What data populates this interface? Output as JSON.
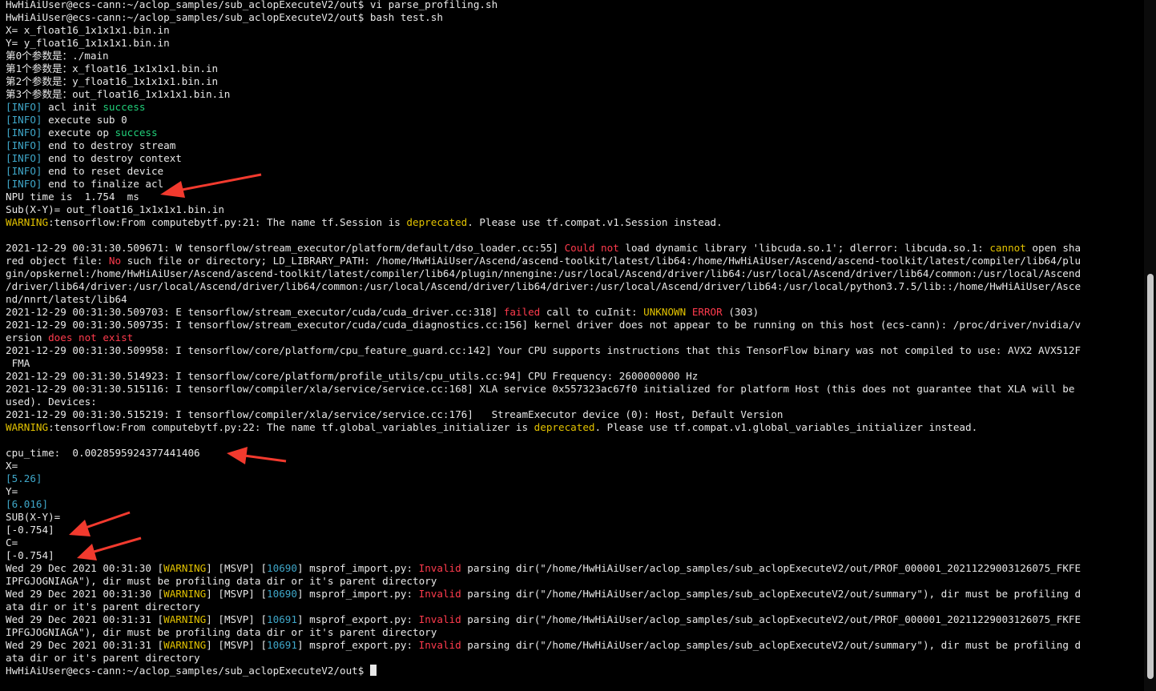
{
  "colors": {
    "background": "#000000",
    "text": "#e8e8e8",
    "cyan": "#3fa7c9",
    "green": "#21d07a",
    "yellow": "#e2c200",
    "red": "#ff3b4d",
    "annotation_arrow": "#f23a2e"
  },
  "annotation_icon": "red-arrow-icon",
  "lines": [
    [
      [
        "d",
        "HwHiAiUser@ecs-cann:~/aclop_samples/sub_aclopExecuteV2/out$ vi parse_profiling.sh"
      ]
    ],
    [
      [
        "d",
        "HwHiAiUser@ecs-cann:~/aclop_samples/sub_aclopExecuteV2/out$ bash test.sh"
      ]
    ],
    [
      [
        "d",
        "X= x_float16_1x1x1x1.bin.in"
      ]
    ],
    [
      [
        "d",
        "Y= y_float16_1x1x1x1.bin.in"
      ]
    ],
    [
      [
        "d",
        "第0个参数是：./main"
      ]
    ],
    [
      [
        "d",
        "第1个参数是：x_float16_1x1x1x1.bin.in"
      ]
    ],
    [
      [
        "d",
        "第2个参数是：y_float16_1x1x1x1.bin.in"
      ]
    ],
    [
      [
        "d",
        "第3个参数是：out_float16_1x1x1x1.bin.in"
      ]
    ],
    [
      [
        "c",
        "[INFO]"
      ],
      [
        "d",
        " acl init "
      ],
      [
        "g",
        "success"
      ]
    ],
    [
      [
        "c",
        "[INFO]"
      ],
      [
        "d",
        " execute sub 0"
      ]
    ],
    [
      [
        "c",
        "[INFO]"
      ],
      [
        "d",
        " execute op "
      ],
      [
        "g",
        "success"
      ]
    ],
    [
      [
        "c",
        "[INFO]"
      ],
      [
        "d",
        " end to destroy stream"
      ]
    ],
    [
      [
        "c",
        "[INFO]"
      ],
      [
        "d",
        " end to destroy context"
      ]
    ],
    [
      [
        "c",
        "[INFO]"
      ],
      [
        "d",
        " end to reset device"
      ]
    ],
    [
      [
        "c",
        "[INFO]"
      ],
      [
        "d",
        " end to finalize acl"
      ]
    ],
    [
      [
        "d",
        "NPU time is  1.754  ms"
      ]
    ],
    [
      [
        "d",
        "Sub(X-Y)= out_float16_1x1x1x1.bin.in"
      ]
    ],
    [
      [
        "y",
        "WARNING"
      ],
      [
        "d",
        ":tensorflow:From computebytf.py:21: The name tf.Session is "
      ],
      [
        "y",
        "deprecated"
      ],
      [
        "d",
        ". Please use tf.compat.v1.Session instead."
      ]
    ],
    [
      [
        "d",
        ""
      ]
    ],
    [
      [
        "d",
        "2021-12-29 00:31:30.509671: W tensorflow/stream_executor/platform/default/dso_loader.cc:55] "
      ],
      [
        "r",
        "Could not"
      ],
      [
        "d",
        " load dynamic library 'libcuda.so.1'; dlerror: libcuda.so.1: "
      ],
      [
        "y",
        "cannot"
      ],
      [
        "d",
        " open sha"
      ]
    ],
    [
      [
        "d",
        "red object file: "
      ],
      [
        "r",
        "No"
      ],
      [
        "d",
        " such file or directory; LD_LIBRARY_PATH: /home/HwHiAiUser/Ascend/ascend-toolkit/latest/lib64:/home/HwHiAiUser/Ascend/ascend-toolkit/latest/compiler/lib64/plu"
      ]
    ],
    [
      [
        "d",
        "gin/opskernel:/home/HwHiAiUser/Ascend/ascend-toolkit/latest/compiler/lib64/plugin/nnengine:/usr/local/Ascend/driver/lib64:/usr/local/Ascend/driver/lib64/common:/usr/local/Ascend"
      ]
    ],
    [
      [
        "d",
        "/driver/lib64/driver:/usr/local/Ascend/driver/lib64/common:/usr/local/Ascend/driver/lib64/driver:/usr/local/Ascend/driver/lib64:/usr/local/python3.7.5/lib::/home/HwHiAiUser/Asce"
      ]
    ],
    [
      [
        "d",
        "nd/nnrt/latest/lib64"
      ]
    ],
    [
      [
        "d",
        "2021-12-29 00:31:30.509703: E tensorflow/stream_executor/cuda/cuda_driver.cc:318] "
      ],
      [
        "r",
        "failed"
      ],
      [
        "d",
        " call to cuInit: "
      ],
      [
        "y",
        "UNKNOWN"
      ],
      [
        "d",
        " "
      ],
      [
        "r",
        "ERROR"
      ],
      [
        "d",
        " (303)"
      ]
    ],
    [
      [
        "d",
        "2021-12-29 00:31:30.509735: I tensorflow/stream_executor/cuda/cuda_diagnostics.cc:156] kernel driver does not appear to be running on this host (ecs-cann): /proc/driver/nvidia/v"
      ]
    ],
    [
      [
        "d",
        "ersion "
      ],
      [
        "r",
        "does not exist"
      ]
    ],
    [
      [
        "d",
        "2021-12-29 00:31:30.509958: I tensorflow/core/platform/cpu_feature_guard.cc:142] Your CPU supports instructions that this TensorFlow binary was not compiled to use: AVX2 AVX512F"
      ]
    ],
    [
      [
        "d",
        " FMA"
      ]
    ],
    [
      [
        "d",
        "2021-12-29 00:31:30.514923: I tensorflow/core/platform/profile_utils/cpu_utils.cc:94] CPU Frequency: 2600000000 Hz"
      ]
    ],
    [
      [
        "d",
        "2021-12-29 00:31:30.515116: I tensorflow/compiler/xla/service/service.cc:168] XLA service 0x557323ac67f0 initialized for platform Host (this does not guarantee that XLA will be"
      ]
    ],
    [
      [
        "d",
        "used). Devices:"
      ]
    ],
    [
      [
        "d",
        "2021-12-29 00:31:30.515219: I tensorflow/compiler/xla/service/service.cc:176]   StreamExecutor device (0): Host, Default Version"
      ]
    ],
    [
      [
        "y",
        "WARNING"
      ],
      [
        "d",
        ":tensorflow:From computebytf.py:22: The name tf.global_variables_initializer is "
      ],
      [
        "y",
        "deprecated"
      ],
      [
        "d",
        ". Please use tf.compat.v1.global_variables_initializer instead."
      ]
    ],
    [
      [
        "d",
        ""
      ]
    ],
    [
      [
        "d",
        "cpu_time:  0.0028595924377441406"
      ]
    ],
    [
      [
        "d",
        "X="
      ]
    ],
    [
      [
        "c",
        "[5.26]"
      ]
    ],
    [
      [
        "d",
        "Y="
      ]
    ],
    [
      [
        "c",
        "[6.016]"
      ]
    ],
    [
      [
        "d",
        "SUB(X-Y)="
      ]
    ],
    [
      [
        "d",
        "[-0.754]"
      ]
    ],
    [
      [
        "d",
        "C="
      ]
    ],
    [
      [
        "d",
        "[-0.754]"
      ]
    ],
    [
      [
        "d",
        "Wed 29 Dec 2021 00:31:30 ["
      ],
      [
        "y",
        "WARNING"
      ],
      [
        "d",
        "] [MSVP] ["
      ],
      [
        "c",
        "10690"
      ],
      [
        "d",
        "] msprof_import.py: "
      ],
      [
        "r",
        "Invalid"
      ],
      [
        "d",
        " parsing dir(\"/home/HwHiAiUser/aclop_samples/sub_aclopExecuteV2/out/PROF_000001_20211229003126075_FKFE"
      ]
    ],
    [
      [
        "d",
        "IPFGJOGNIAGA\"), dir must be profiling data dir or it's parent directory"
      ]
    ],
    [
      [
        "d",
        "Wed 29 Dec 2021 00:31:30 ["
      ],
      [
        "y",
        "WARNING"
      ],
      [
        "d",
        "] [MSVP] ["
      ],
      [
        "c",
        "10690"
      ],
      [
        "d",
        "] msprof_import.py: "
      ],
      [
        "r",
        "Invalid"
      ],
      [
        "d",
        " parsing dir(\"/home/HwHiAiUser/aclop_samples/sub_aclopExecuteV2/out/summary\"), dir must be profiling d"
      ]
    ],
    [
      [
        "d",
        "ata dir or it's parent directory"
      ]
    ],
    [
      [
        "d",
        "Wed 29 Dec 2021 00:31:31 ["
      ],
      [
        "y",
        "WARNING"
      ],
      [
        "d",
        "] [MSVP] ["
      ],
      [
        "c",
        "10691"
      ],
      [
        "d",
        "] msprof_export.py: "
      ],
      [
        "r",
        "Invalid"
      ],
      [
        "d",
        " parsing dir(\"/home/HwHiAiUser/aclop_samples/sub_aclopExecuteV2/out/PROF_000001_20211229003126075_FKFE"
      ]
    ],
    [
      [
        "d",
        "IPFGJOGNIAGA\"), dir must be profiling data dir or it's parent directory"
      ]
    ],
    [
      [
        "d",
        "Wed 29 Dec 2021 00:31:31 ["
      ],
      [
        "y",
        "WARNING"
      ],
      [
        "d",
        "] [MSVP] ["
      ],
      [
        "c",
        "10691"
      ],
      [
        "d",
        "] msprof_export.py: "
      ],
      [
        "r",
        "Invalid"
      ],
      [
        "d",
        " parsing dir(\"/home/HwHiAiUser/aclop_samples/sub_aclopExecuteV2/out/summary\"), dir must be profiling d"
      ]
    ],
    [
      [
        "d",
        "ata dir or it's parent directory"
      ]
    ],
    [
      [
        "d",
        "HwHiAiUser@ecs-cann:~/aclop_samples/sub_aclopExecuteV2/out$ "
      ]
    ]
  ]
}
